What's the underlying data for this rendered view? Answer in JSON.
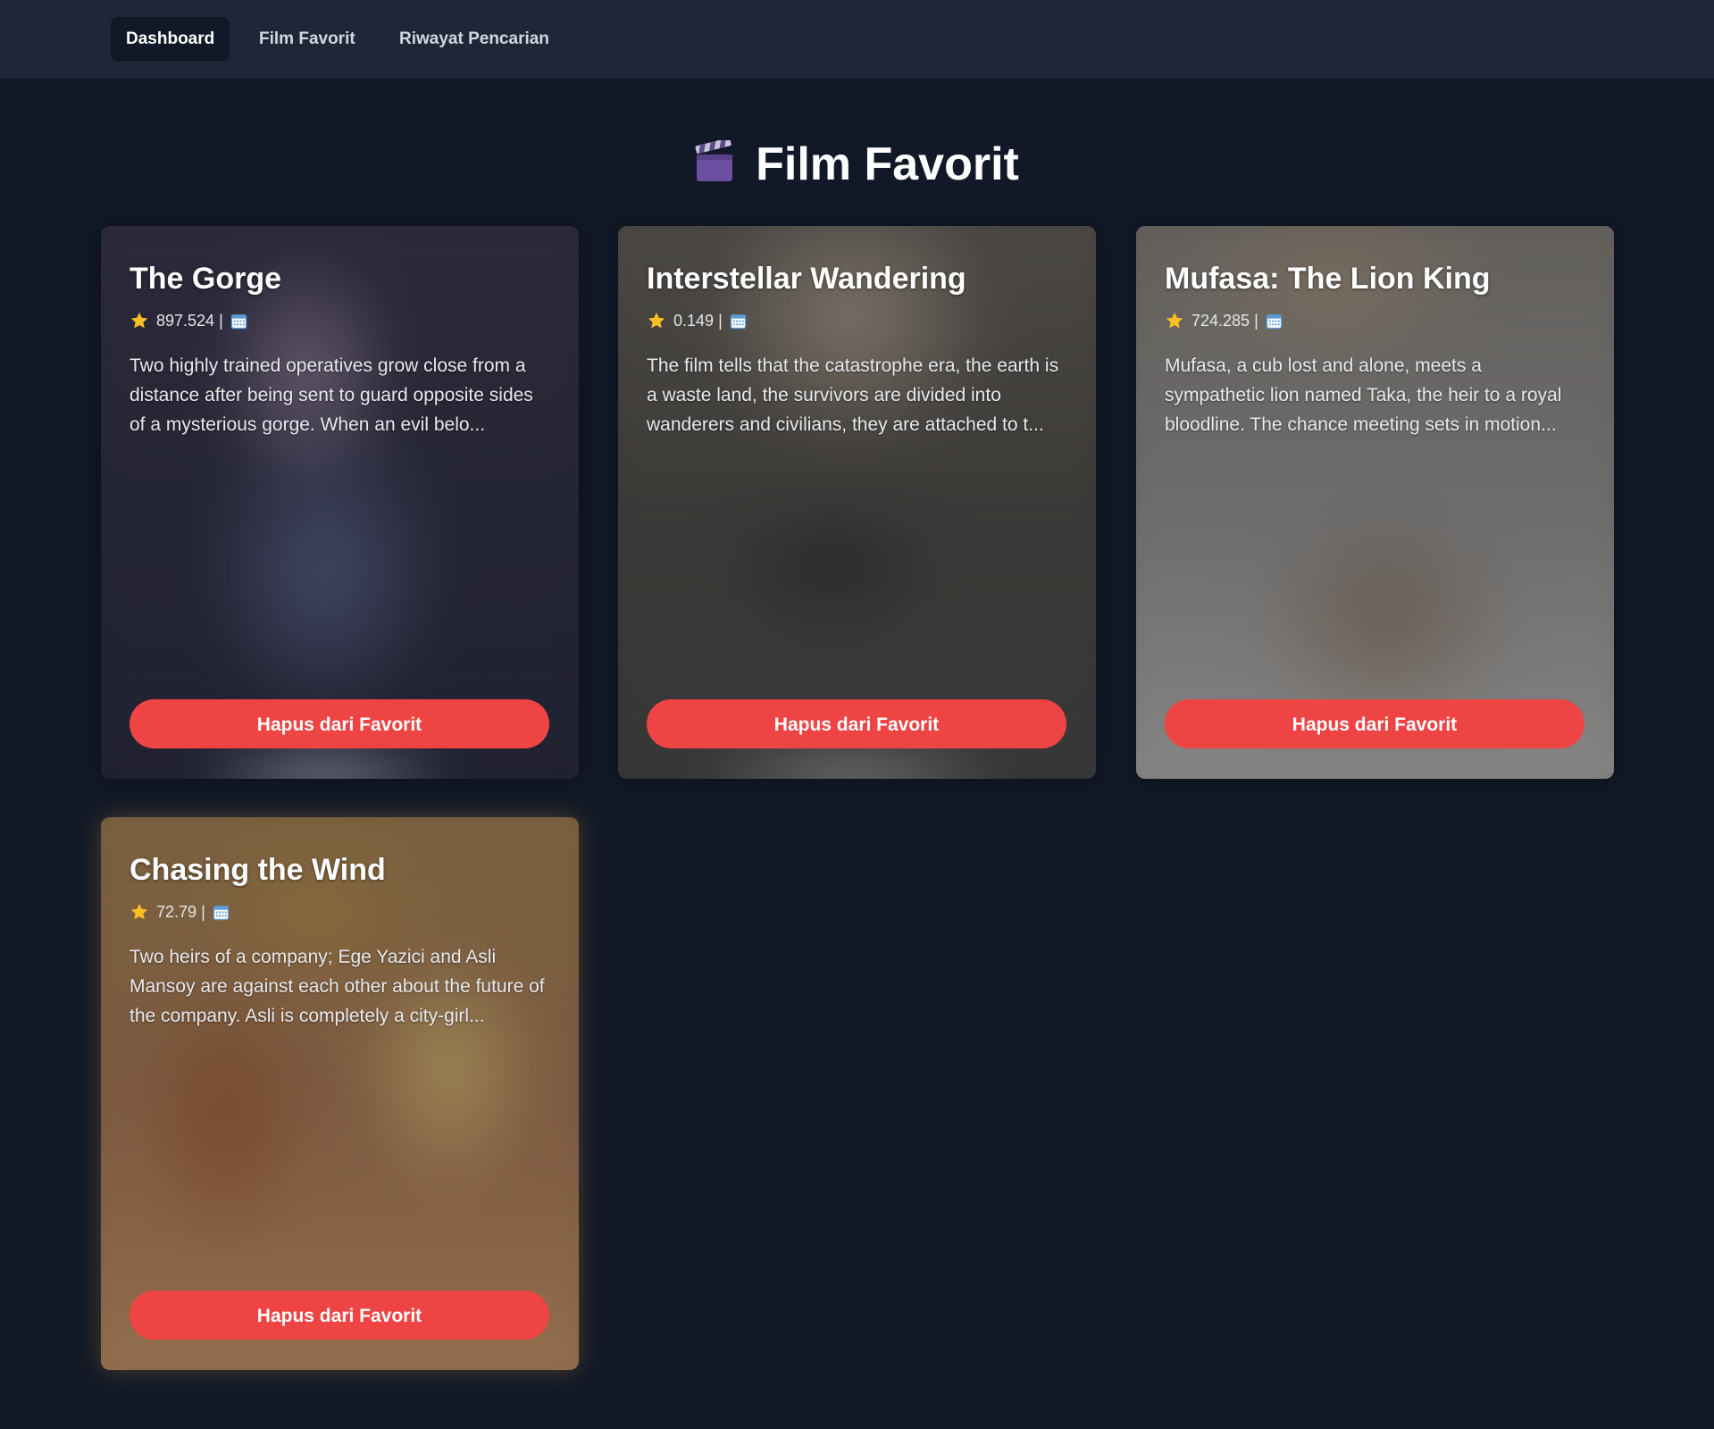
{
  "nav": {
    "items": [
      {
        "label": "Dashboard",
        "active": true
      },
      {
        "label": "Film Favorit",
        "active": false
      },
      {
        "label": "Riwayat Pencarian",
        "active": false
      }
    ]
  },
  "page": {
    "title": "Film Favorit",
    "title_icon": "clapper-board-icon"
  },
  "colors": {
    "background": "#121827",
    "navbar": "#1e2737",
    "active_nav": "#111827",
    "button": "#ef4444"
  },
  "movies": [
    {
      "title": "The Gorge",
      "rating": "897.524",
      "separator": "|",
      "description": "Two highly trained operatives grow close from a distance after being sent to guard opposite sides of a mysterious gorge. When an evil belo...",
      "button_label": "Hapus dari Favorit"
    },
    {
      "title": "Interstellar Wandering",
      "rating": "0.149",
      "separator": "|",
      "description": "The film tells that the catastrophe era, the earth is a waste land, the survivors are divided into wanderers and civilians, they are attached to t...",
      "button_label": "Hapus dari Favorit"
    },
    {
      "title": "Mufasa: The Lion King",
      "rating": "724.285",
      "separator": "|",
      "description": "Mufasa, a cub lost and alone, meets a sympathetic lion named Taka, the heir to a royal bloodline. The chance meeting sets in motion...",
      "button_label": "Hapus dari Favorit"
    },
    {
      "title": "Chasing the Wind",
      "rating": "72.79",
      "separator": "|",
      "description": "Two heirs of a company; Ege Yazici and Asli Mansoy are against each other about the future of the company. Asli is completely a city-girl...",
      "button_label": "Hapus dari Favorit"
    }
  ]
}
